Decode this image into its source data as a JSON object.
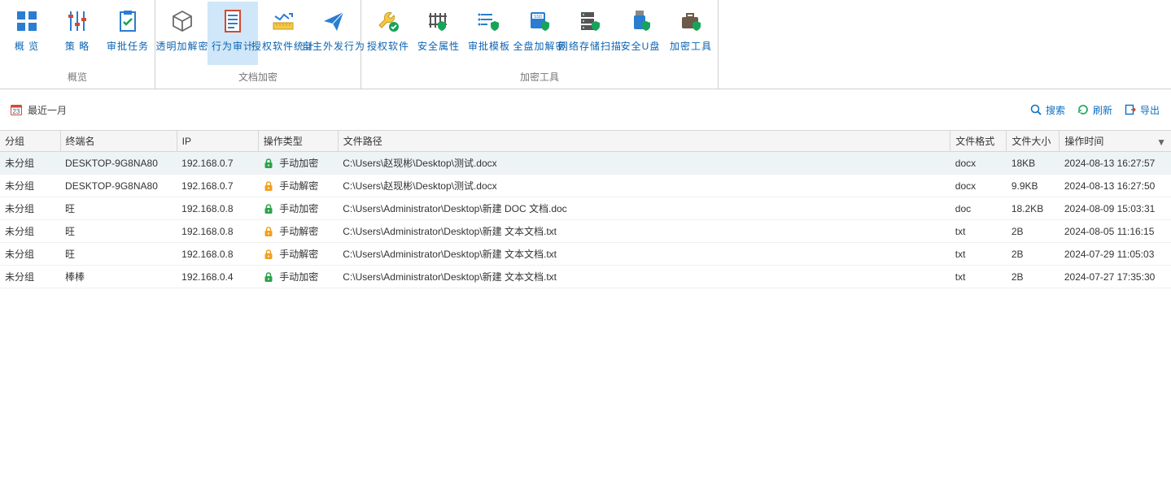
{
  "ribbon": {
    "groups": [
      {
        "label": "概览",
        "items": [
          {
            "name": "overview",
            "label": "概 览",
            "icon": "grid"
          },
          {
            "name": "strategy",
            "label": "策 略",
            "icon": "sliders"
          },
          {
            "name": "approval",
            "label": "审批任务",
            "icon": "clipboard-check"
          }
        ]
      },
      {
        "label": "文档加密",
        "items": [
          {
            "name": "transparent-encrypt",
            "label": "透明加解密",
            "icon": "cube"
          },
          {
            "name": "behavior-audit",
            "label": "行为审计",
            "icon": "doc-lines",
            "active": true
          },
          {
            "name": "software-stats",
            "label": "授权软件统计",
            "icon": "ruler-chart"
          },
          {
            "name": "self-outgoing",
            "label": "自主外发行为",
            "icon": "paper-plane"
          }
        ]
      },
      {
        "label": "加密工具",
        "items": [
          {
            "name": "auth-software",
            "label": "授权软件",
            "icon": "wrench-check"
          },
          {
            "name": "security-attr",
            "label": "安全属性",
            "icon": "fence-shield"
          },
          {
            "name": "approval-tpl",
            "label": "审批模板",
            "icon": "list-shield"
          },
          {
            "name": "full-disk",
            "label": "全盘加解密",
            "icon": "ssd-shield"
          },
          {
            "name": "network-scan",
            "label": "网络存储扫描",
            "icon": "server-shield"
          },
          {
            "name": "secure-usb",
            "label": "安全U盘",
            "icon": "usb-shield"
          },
          {
            "name": "encrypt-tools",
            "label": "加密工具",
            "icon": "briefcase-shield"
          }
        ]
      }
    ]
  },
  "filter": {
    "date_range_label": "最近一月",
    "calendar_day": "23",
    "actions": {
      "search": "搜索",
      "refresh": "刷新",
      "export": "导出"
    }
  },
  "table": {
    "columns": {
      "group": "分组",
      "terminal": "终端名",
      "ip": "IP",
      "op": "操作类型",
      "path": "文件路径",
      "fmt": "文件格式",
      "size": "文件大小",
      "time": "操作时间"
    },
    "op_labels": {
      "manual_encrypt": "手动加密",
      "manual_decrypt": "手动解密"
    },
    "rows": [
      {
        "group": "未分组",
        "terminal": "DESKTOP-9G8NA80",
        "ip": "192.168.0.7",
        "op": "manual_encrypt",
        "path": "C:\\Users\\赵现彬\\Desktop\\测试.docx",
        "fmt": "docx",
        "size": "18KB",
        "time": "2024-08-13 16:27:57",
        "hover": true
      },
      {
        "group": "未分组",
        "terminal": "DESKTOP-9G8NA80",
        "ip": "192.168.0.7",
        "op": "manual_decrypt",
        "path": "C:\\Users\\赵现彬\\Desktop\\测试.docx",
        "fmt": "docx",
        "size": "9.9KB",
        "time": "2024-08-13 16:27:50"
      },
      {
        "group": "未分组",
        "terminal": "旺",
        "ip": "192.168.0.8",
        "op": "manual_encrypt",
        "path": "C:\\Users\\Administrator\\Desktop\\新建 DOC 文档.doc",
        "fmt": "doc",
        "size": "18.2KB",
        "time": "2024-08-09 15:03:31"
      },
      {
        "group": "未分组",
        "terminal": "旺",
        "ip": "192.168.0.8",
        "op": "manual_decrypt",
        "path": "C:\\Users\\Administrator\\Desktop\\新建 文本文档.txt",
        "fmt": "txt",
        "size": "2B",
        "time": "2024-08-05 11:16:15"
      },
      {
        "group": "未分组",
        "terminal": "旺",
        "ip": "192.168.0.8",
        "op": "manual_decrypt",
        "path": "C:\\Users\\Administrator\\Desktop\\新建 文本文档.txt",
        "fmt": "txt",
        "size": "2B",
        "time": "2024-07-29 11:05:03"
      },
      {
        "group": "未分组",
        "terminal": "棒棒",
        "ip": "192.168.0.4",
        "op": "manual_encrypt",
        "path": "C:\\Users\\Administrator\\Desktop\\新建 文本文档.txt",
        "fmt": "txt",
        "size": "2B",
        "time": "2024-07-27 17:35:30"
      }
    ]
  }
}
